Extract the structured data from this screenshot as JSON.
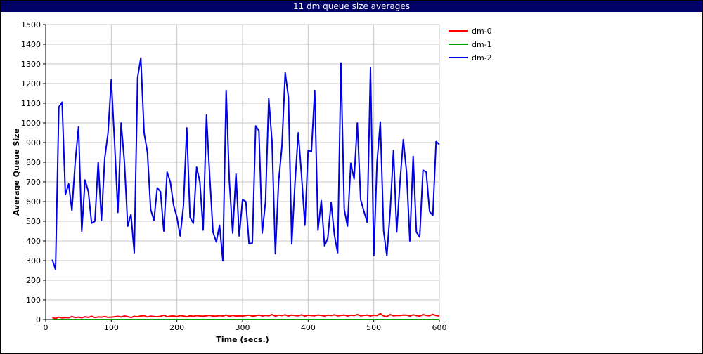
{
  "window": {
    "title": "11 dm queue size averages"
  },
  "chart_data": {
    "type": "line",
    "title": "11 dm queue size averages",
    "xlabel": "Time (secs.)",
    "ylabel": "Average Queue Size",
    "xlim": [
      0,
      600
    ],
    "ylim": [
      0,
      1500
    ],
    "xticks": [
      0,
      100,
      200,
      300,
      400,
      500,
      600
    ],
    "yticks": [
      0,
      100,
      200,
      300,
      400,
      500,
      600,
      700,
      800,
      900,
      1000,
      1100,
      1200,
      1300,
      1400,
      1500
    ],
    "grid": true,
    "legend_position": "right-top",
    "series": [
      {
        "name": "dm-0",
        "color": "#ff0000",
        "x": [
          10,
          15,
          20,
          25,
          30,
          35,
          40,
          45,
          50,
          55,
          60,
          65,
          70,
          75,
          80,
          85,
          90,
          95,
          100,
          105,
          110,
          115,
          120,
          125,
          130,
          135,
          140,
          145,
          150,
          155,
          160,
          165,
          170,
          175,
          180,
          185,
          190,
          195,
          200,
          205,
          210,
          215,
          220,
          225,
          230,
          235,
          240,
          245,
          250,
          255,
          260,
          265,
          270,
          275,
          280,
          285,
          290,
          295,
          300,
          305,
          310,
          315,
          320,
          325,
          330,
          335,
          340,
          345,
          350,
          355,
          360,
          365,
          370,
          375,
          380,
          385,
          390,
          395,
          400,
          405,
          410,
          415,
          420,
          425,
          430,
          435,
          440,
          445,
          450,
          455,
          460,
          465,
          470,
          475,
          480,
          485,
          490,
          495,
          500,
          505,
          510,
          515,
          520,
          525,
          530,
          535,
          540,
          545,
          550,
          555,
          560,
          565,
          570,
          575,
          580,
          585,
          590,
          595,
          600
        ],
        "y": [
          10,
          5,
          12,
          8,
          10,
          9,
          15,
          10,
          12,
          9,
          14,
          11,
          16,
          10,
          13,
          12,
          15,
          11,
          12,
          14,
          16,
          13,
          18,
          15,
          10,
          16,
          14,
          18,
          20,
          13,
          17,
          15,
          14,
          16,
          22,
          14,
          17,
          18,
          15,
          20,
          18,
          14,
          19,
          16,
          20,
          18,
          17,
          19,
          21,
          18,
          17,
          20,
          18,
          23,
          16,
          21,
          17,
          19,
          18,
          20,
          22,
          17,
          19,
          23,
          18,
          21,
          19,
          25,
          17,
          22,
          20,
          24,
          18,
          23,
          20,
          19,
          24,
          17,
          22,
          20,
          19,
          23,
          21,
          18,
          22,
          20,
          24,
          19,
          21,
          23,
          18,
          22,
          20,
          25,
          19,
          21,
          23,
          18,
          22,
          20,
          30,
          18,
          15,
          25,
          19,
          21,
          20,
          23,
          22,
          18,
          24,
          20,
          17,
          25,
          21,
          19,
          26,
          20,
          18
        ]
      },
      {
        "name": "dm-1",
        "color": "#00a000",
        "x": [
          10,
          100,
          200,
          300,
          400,
          500,
          600
        ],
        "y": [
          0,
          0,
          0,
          0,
          0,
          0,
          0
        ]
      },
      {
        "name": "dm-2",
        "color": "#0000e6",
        "x": [
          10,
          15,
          20,
          25,
          30,
          35,
          40,
          45,
          50,
          55,
          60,
          65,
          70,
          75,
          80,
          85,
          90,
          95,
          100,
          105,
          110,
          115,
          120,
          125,
          130,
          135,
          140,
          145,
          150,
          155,
          160,
          165,
          170,
          175,
          180,
          185,
          190,
          195,
          200,
          205,
          210,
          215,
          220,
          225,
          230,
          235,
          240,
          245,
          250,
          255,
          260,
          265,
          270,
          275,
          280,
          285,
          290,
          295,
          300,
          305,
          310,
          315,
          320,
          325,
          330,
          335,
          340,
          345,
          350,
          355,
          360,
          365,
          370,
          375,
          380,
          385,
          390,
          395,
          400,
          405,
          410,
          415,
          420,
          425,
          430,
          435,
          440,
          445,
          450,
          455,
          460,
          465,
          470,
          475,
          480,
          485,
          490,
          495,
          500,
          505,
          510,
          515,
          520,
          525,
          530,
          535,
          540,
          545,
          550,
          555,
          560,
          565,
          570,
          575,
          580,
          585,
          590,
          595,
          600
        ],
        "y": [
          305,
          255,
          1080,
          1105,
          635,
          690,
          555,
          800,
          980,
          450,
          710,
          650,
          490,
          500,
          800,
          505,
          820,
          950,
          1220,
          900,
          545,
          1000,
          800,
          475,
          535,
          340,
          1230,
          1330,
          950,
          850,
          560,
          505,
          670,
          650,
          450,
          750,
          700,
          580,
          520,
          425,
          580,
          975,
          520,
          490,
          775,
          700,
          455,
          1040,
          730,
          445,
          395,
          480,
          300,
          1165,
          700,
          440,
          740,
          425,
          610,
          600,
          385,
          390,
          985,
          960,
          440,
          600,
          1125,
          900,
          335,
          700,
          880,
          1255,
          1130,
          385,
          700,
          950,
          730,
          480,
          860,
          855,
          1165,
          455,
          605,
          375,
          415,
          595,
          430,
          340,
          1305,
          560,
          475,
          795,
          715,
          1000,
          610,
          550,
          495,
          1280,
          325,
          800,
          1005,
          450,
          325,
          550,
          860,
          445,
          700,
          915,
          750,
          400,
          830,
          445,
          420,
          760,
          750,
          550,
          530,
          905,
          890
        ]
      }
    ]
  }
}
